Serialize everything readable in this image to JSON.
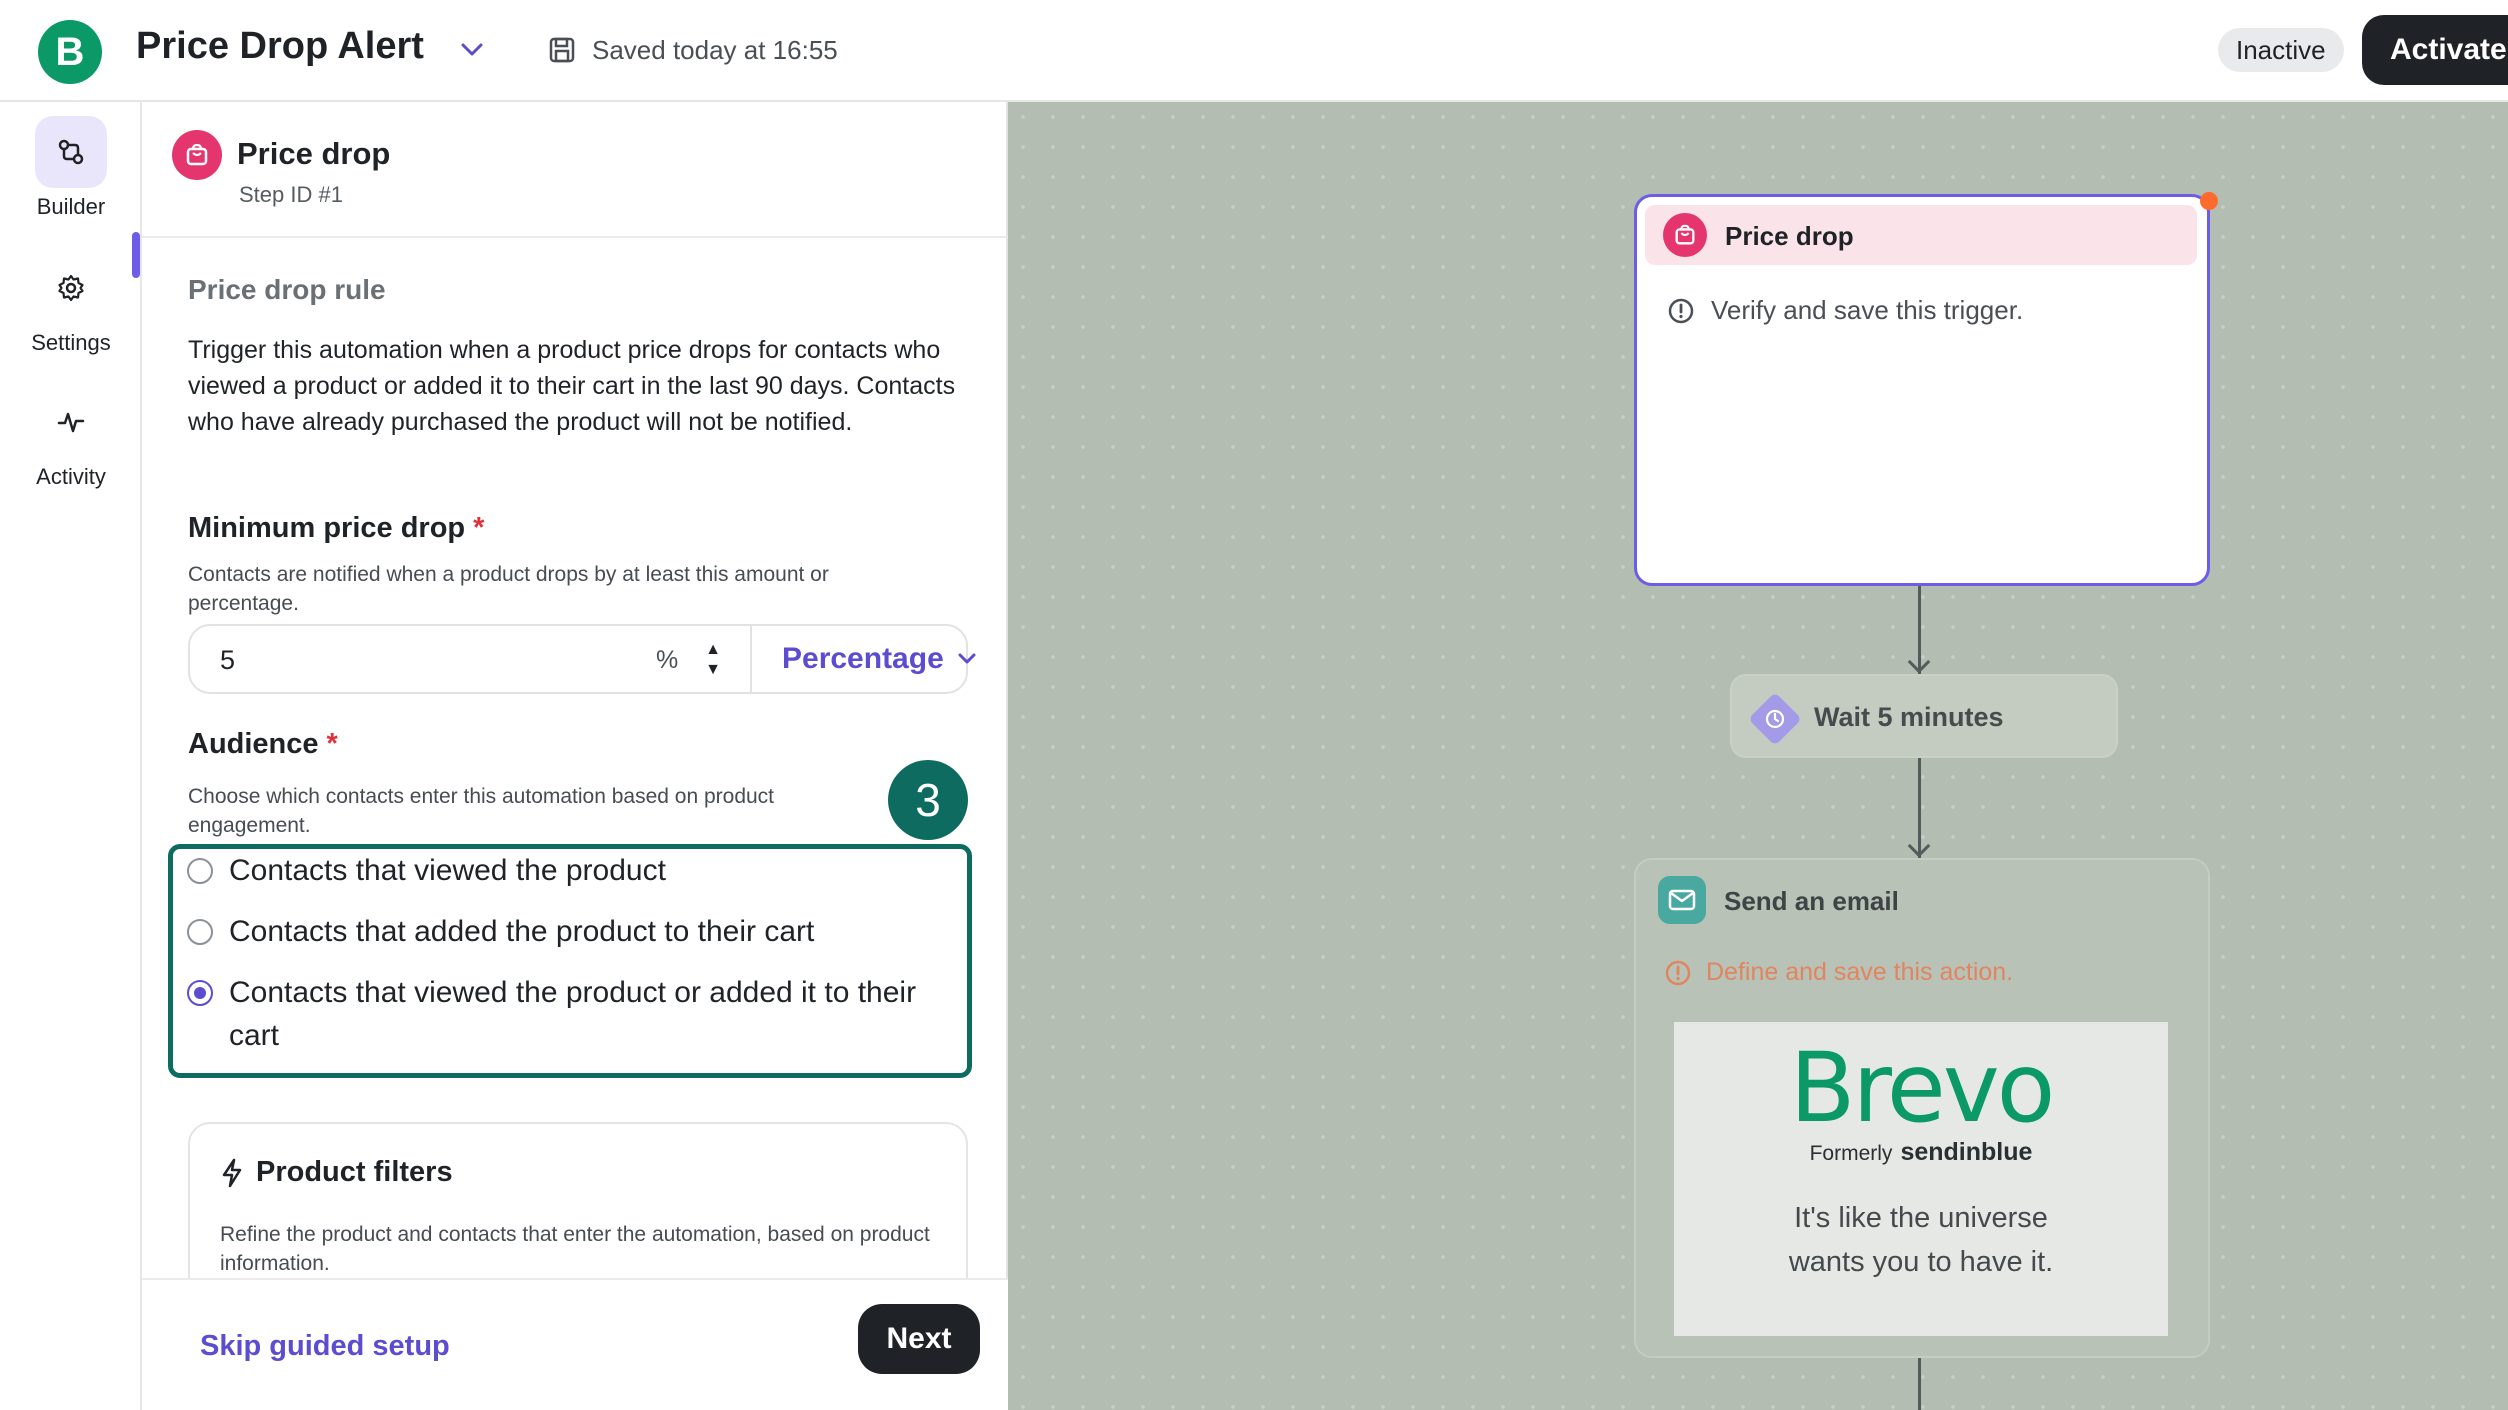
{
  "header": {
    "logo_letter": "B",
    "title": "Price Drop Alert",
    "saved_text": "Saved today at 16:55",
    "status": "Inactive",
    "activate_label": "Activate"
  },
  "rail": {
    "items": [
      {
        "label": "Builder",
        "icon": "builder-icon",
        "active": true
      },
      {
        "label": "Settings",
        "icon": "gear-icon",
        "active": false
      },
      {
        "label": "Activity",
        "icon": "activity-icon",
        "active": false
      }
    ]
  },
  "panel": {
    "trigger_title": "Price drop",
    "step_id": "Step ID #1",
    "section_title": "Price drop rule",
    "description": "Trigger this automation when a product price drops for contacts who viewed a product or added it to their cart in the last 90 days. Contacts who have already purchased the product will not be notified.",
    "min_drop": {
      "label": "Minimum price drop",
      "required_mark": "*",
      "help": "Contacts are notified when a product drops by at least this amount or percentage.",
      "value": "5",
      "unit_symbol": "%",
      "unit_select": "Percentage"
    },
    "audience": {
      "label": "Audience",
      "required_mark": "*",
      "help": "Choose which contacts enter this automation based on product engagement.",
      "step_badge": "3",
      "options": [
        {
          "label": "Contacts that viewed the product",
          "checked": false
        },
        {
          "label": "Contacts that added the product to their cart",
          "checked": false
        },
        {
          "label": "Contacts that viewed the product or added it to their cart",
          "checked": true
        }
      ]
    },
    "filters": {
      "title": "Product filters",
      "help": "Refine the product and contacts that enter the automation, based on product information."
    },
    "footer": {
      "skip_label": "Skip guided setup",
      "next_label": "Next"
    }
  },
  "canvas": {
    "trigger_node": {
      "title": "Price drop",
      "warning": "Verify and save this trigger."
    },
    "wait_node": {
      "label": "Wait 5 minutes"
    },
    "email_node": {
      "title": "Send an email",
      "warning": "Define and save this action.",
      "preview_brand": "Brevo",
      "preview_formerly": "Formerly",
      "preview_sub_brand": "sendinblue",
      "preview_tagline": "It's like the universe wants you to have it."
    }
  },
  "colors": {
    "brand_green": "#0b9968",
    "accent_purple": "#5c4ccf",
    "highlight_teal": "#0e6b5f",
    "trigger_pink": "#e5356f",
    "warning_orange": "#e0855f",
    "canvas_bg": "#b4bdb1"
  }
}
